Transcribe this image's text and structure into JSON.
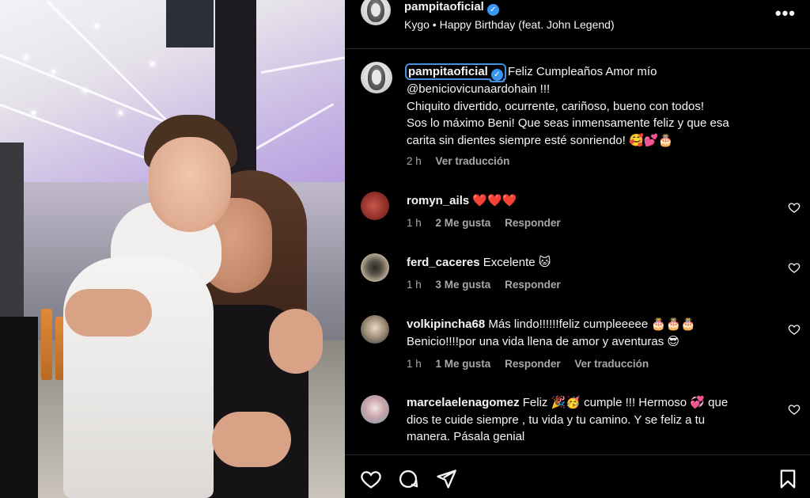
{
  "post": {
    "image_alt": "Photo of a boy in white hoodie hugging a smiling woman in an airport terminal"
  },
  "header": {
    "username": "pampitaoficial",
    "music": "Kygo • Happy Birthday (feat. John Legend)",
    "more_label": "•••"
  },
  "caption": {
    "username": "pampitaoficial",
    "text_line1": "Feliz Cumpleaños Amor mío",
    "text_line2": "@beniciovicunaardohain !!!",
    "text_line3": "Chiquito divertido, ocurrente, cariñoso, bueno con todos!",
    "text_line4": "Sos lo máximo Beni! Que seas inmensamente feliz y que esa",
    "text_line5": "carita sin dientes siempre esté sonriendo! 🥰💕🎂",
    "time": "2 h",
    "translate": "Ver traducción"
  },
  "comments": [
    {
      "username": "romyn_ails",
      "text": "❤️❤️❤️",
      "time": "1 h",
      "likes": "2 Me gusta",
      "reply": "Responder"
    },
    {
      "username": "ferd_caceres",
      "text": "Excelente 🐱",
      "time": "1 h",
      "likes": "3 Me gusta",
      "reply": "Responder"
    },
    {
      "username": "volkipincha68",
      "text": "Más lindo!!!!!!feliz cumpleeeee 🎂🎂🎂",
      "text_line2": "Benicio!!!!por una vida llena de amor y aventuras 😎",
      "time": "1 h",
      "likes": "1 Me gusta",
      "reply": "Responder",
      "translate": "Ver traducción"
    },
    {
      "username": "marcelaelenagomez",
      "text": "Feliz 🎉🥳 cumple !!! Hermoso 💞 que",
      "text_line2": "dios te cuide siempre , tu vida y tu camino. Y se feliz a tu",
      "text_line3": "manera. Pásala genial"
    }
  ],
  "colors": {
    "background": "#000000",
    "text": "#f5f5f5",
    "muted": "#a8a8a8",
    "verified": "#3897f0"
  }
}
